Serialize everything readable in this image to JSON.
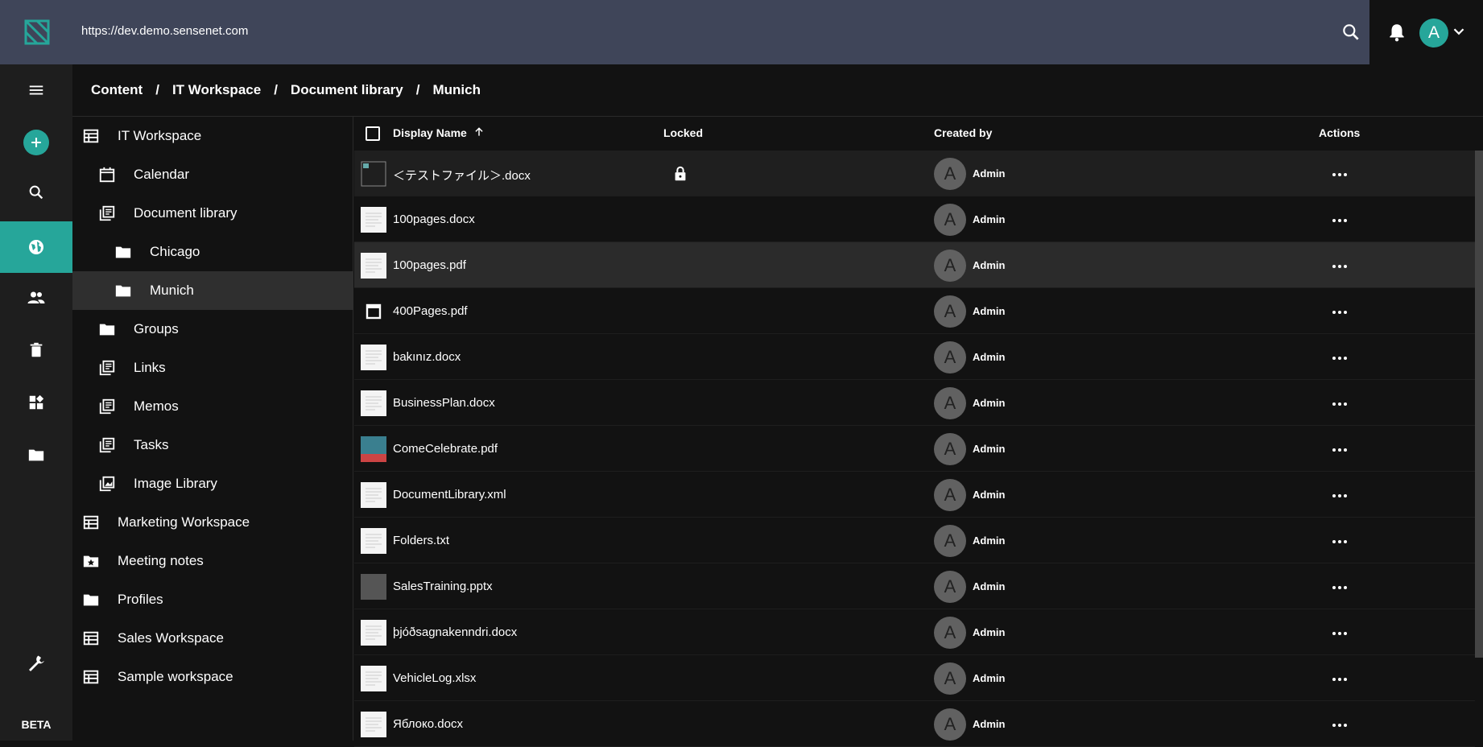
{
  "header": {
    "url": "https://dev.demo.sensenet.com",
    "avatar_letter": "A"
  },
  "rail": {
    "beta": "BETA"
  },
  "breadcrumb": [
    "Content",
    "IT Workspace",
    "Document library",
    "Munich"
  ],
  "tree": [
    {
      "label": "IT Workspace",
      "icon": "workspace-icon",
      "level": 0
    },
    {
      "label": "Calendar",
      "icon": "calendar-icon",
      "level": 1
    },
    {
      "label": "Document library",
      "icon": "library-icon",
      "level": 1
    },
    {
      "label": "Chicago",
      "icon": "folder-icon",
      "level": 2
    },
    {
      "label": "Munich",
      "icon": "folder-icon",
      "level": 2,
      "selected": true
    },
    {
      "label": "Groups",
      "icon": "folder-icon",
      "level": 1
    },
    {
      "label": "Links",
      "icon": "library-icon",
      "level": 1
    },
    {
      "label": "Memos",
      "icon": "library-icon",
      "level": 1
    },
    {
      "label": "Tasks",
      "icon": "library-icon",
      "level": 1
    },
    {
      "label": "Image Library",
      "icon": "image-library-icon",
      "level": 1
    },
    {
      "label": "Marketing Workspace",
      "icon": "workspace-icon",
      "level": 0
    },
    {
      "label": "Meeting notes",
      "icon": "folder-star-icon",
      "level": 0
    },
    {
      "label": "Profiles",
      "icon": "folder-icon",
      "level": 0
    },
    {
      "label": "Sales Workspace",
      "icon": "workspace-icon",
      "level": 0
    },
    {
      "label": "Sample workspace",
      "icon": "workspace-icon",
      "level": 0
    }
  ],
  "grid": {
    "columns": {
      "name": "Display Name",
      "locked": "Locked",
      "created_by": "Created by",
      "actions": "Actions"
    },
    "rows": [
      {
        "name": "＜テストファイル＞.docx",
        "locked": true,
        "user": "Admin",
        "avatar": "A",
        "thumb": "broken-image"
      },
      {
        "name": "100pages.docx",
        "locked": false,
        "user": "Admin",
        "avatar": "A",
        "thumb": "doc"
      },
      {
        "name": "100pages.pdf",
        "locked": false,
        "user": "Admin",
        "avatar": "A",
        "thumb": "doc",
        "highlight": true
      },
      {
        "name": "400Pages.pdf",
        "locked": false,
        "user": "Admin",
        "avatar": "A",
        "thumb": "window-icon"
      },
      {
        "name": "bakınız.docx",
        "locked": false,
        "user": "Admin",
        "avatar": "A",
        "thumb": "doc"
      },
      {
        "name": "BusinessPlan.docx",
        "locked": false,
        "user": "Admin",
        "avatar": "A",
        "thumb": "doc"
      },
      {
        "name": "ComeCelebrate.pdf",
        "locked": false,
        "user": "Admin",
        "avatar": "A",
        "thumb": "image"
      },
      {
        "name": "DocumentLibrary.xml",
        "locked": false,
        "user": "Admin",
        "avatar": "A",
        "thumb": "doc"
      },
      {
        "name": "Folders.txt",
        "locked": false,
        "user": "Admin",
        "avatar": "A",
        "thumb": "doc"
      },
      {
        "name": "SalesTraining.pptx",
        "locked": false,
        "user": "Admin",
        "avatar": "A",
        "thumb": "dark"
      },
      {
        "name": "þjóðsagnakenndri.docx",
        "locked": false,
        "user": "Admin",
        "avatar": "A",
        "thumb": "doc"
      },
      {
        "name": "VehicleLog.xlsx",
        "locked": false,
        "user": "Admin",
        "avatar": "A",
        "thumb": "doc"
      },
      {
        "name": "Яблоко.docx",
        "locked": false,
        "user": "Admin",
        "avatar": "A",
        "thumb": "doc"
      }
    ]
  }
}
